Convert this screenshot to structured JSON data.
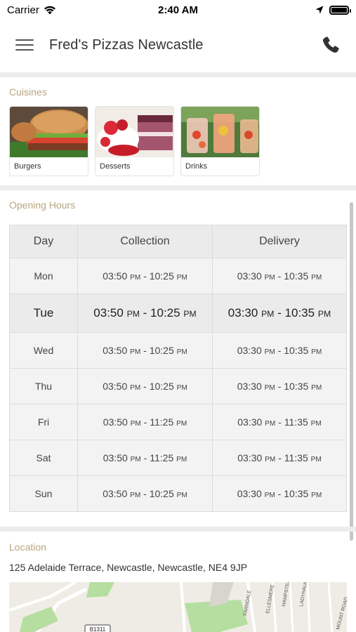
{
  "status_bar": {
    "carrier": "Carrier",
    "time": "2:40 AM"
  },
  "app_bar": {
    "title": "Fred's Pizzas Newcastle"
  },
  "cuisines": {
    "heading": "Cuisines",
    "items": [
      {
        "label": "Burgers",
        "image": "burger-image"
      },
      {
        "label": "Desserts",
        "image": "dessert-image"
      },
      {
        "label": "Drinks",
        "image": "drinks-image"
      }
    ]
  },
  "opening_hours": {
    "heading": "Opening Hours",
    "columns": [
      "Day",
      "Collection",
      "Delivery"
    ],
    "rows": [
      {
        "day": "Mon",
        "c_open": "03:50",
        "c_close": "10:25",
        "d_open": "03:30",
        "d_close": "10:35"
      },
      {
        "day": "Tue",
        "c_open": "03:50",
        "c_close": "10:25",
        "d_open": "03:30",
        "d_close": "10:35"
      },
      {
        "day": "Wed",
        "c_open": "03:50",
        "c_close": "10:25",
        "d_open": "03:30",
        "d_close": "10:35"
      },
      {
        "day": "Thu",
        "c_open": "03:50",
        "c_close": "10:25",
        "d_open": "03:30",
        "d_close": "10:35"
      },
      {
        "day": "Fri",
        "c_open": "03:50",
        "c_close": "11:25",
        "d_open": "03:30",
        "d_close": "11:35"
      },
      {
        "day": "Sat",
        "c_open": "03:50",
        "c_close": "11:25",
        "d_open": "03:30",
        "d_close": "11:35"
      },
      {
        "day": "Sun",
        "c_open": "03:50",
        "c_close": "10:25",
        "d_open": "03:30",
        "d_close": "10:35"
      }
    ],
    "pm": "PM",
    "separator": " - ",
    "today": "Tue"
  },
  "location": {
    "heading": "Location",
    "address": "125 Adelaide Terrace, Newcastle, Newcastle, NE4 9JP",
    "map_labels": [
      "B1311",
      "FARNDALE",
      "ELLESMERE",
      "HAMPSTEAD",
      "LADYHAUGH",
      "MOUNT ROAD"
    ]
  },
  "colors": {
    "accent_heading": "#b8a57f",
    "divider": "#ececec",
    "table_header": "#ebebeb",
    "map_green": "#a9d88f"
  }
}
